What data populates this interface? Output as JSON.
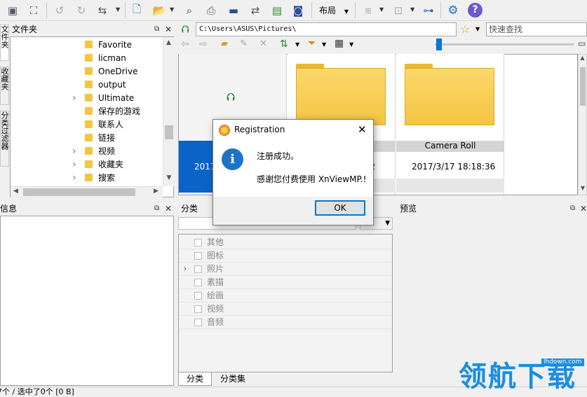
{
  "toolbar": {
    "layout_label": "布局",
    "icons": [
      "monitor-icon",
      "fullscreen-icon",
      "rotate-left-icon",
      "rotate-right-icon",
      "transform-icon",
      "document-icon",
      "export-icon",
      "binoculars-icon",
      "printer-icon",
      "display-icon",
      "convert-icon",
      "slideshow-icon",
      "camera-icon",
      "layout-icon",
      "compare-icon",
      "bookmark-icon",
      "network-icon",
      "settings-icon",
      "help-icon"
    ]
  },
  "sidebar_vtabs": [
    "文件夹",
    "收藏夹",
    "分类过滤器"
  ],
  "folders_panel": {
    "title": "文件夹",
    "items": [
      {
        "label": "Favorite",
        "expand": false
      },
      {
        "label": "licman",
        "expand": false
      },
      {
        "label": "OneDrive",
        "expand": false
      },
      {
        "label": "output",
        "expand": false
      },
      {
        "label": "Ultimate",
        "expand": true
      },
      {
        "label": "保存的游戏",
        "expand": false
      },
      {
        "label": "联系人",
        "expand": false
      },
      {
        "label": "链接",
        "expand": false
      },
      {
        "label": "视频",
        "expand": true
      },
      {
        "label": "收藏夹",
        "expand": true
      },
      {
        "label": "搜索",
        "expand": true
      }
    ]
  },
  "address": {
    "path": "C:\\Users\\ASUS\\Pictures\\",
    "search_placeholder": "快速查找"
  },
  "thumbnails": [
    {
      "name": "",
      "date": "2017"
    },
    {
      "name": "",
      "date": "52"
    },
    {
      "name": "Camera Roll",
      "date": "2017/3/17 18:18:36"
    }
  ],
  "info_panel": {
    "title": "信息"
  },
  "category_panel": {
    "title": "分类",
    "items": [
      "其他",
      "图标",
      "照片",
      "素描",
      "绘画",
      "视频",
      "音频"
    ],
    "tabs": [
      "分类",
      "分类集"
    ]
  },
  "preview_panel": {
    "title": "预览"
  },
  "status": {
    "text": "7个 / 选中了0个 [0 B]"
  },
  "dialog": {
    "title": "Registration",
    "line1": "注册成功。",
    "line2": "感谢您付费使用 XnViewMP.!",
    "ok": "OK"
  },
  "watermark": {
    "text": "领航下载",
    "url": "lhdown.com"
  },
  "colors": {
    "accent": "#0078d7",
    "folder": "#f4c542",
    "selection": "#0a64c8"
  }
}
